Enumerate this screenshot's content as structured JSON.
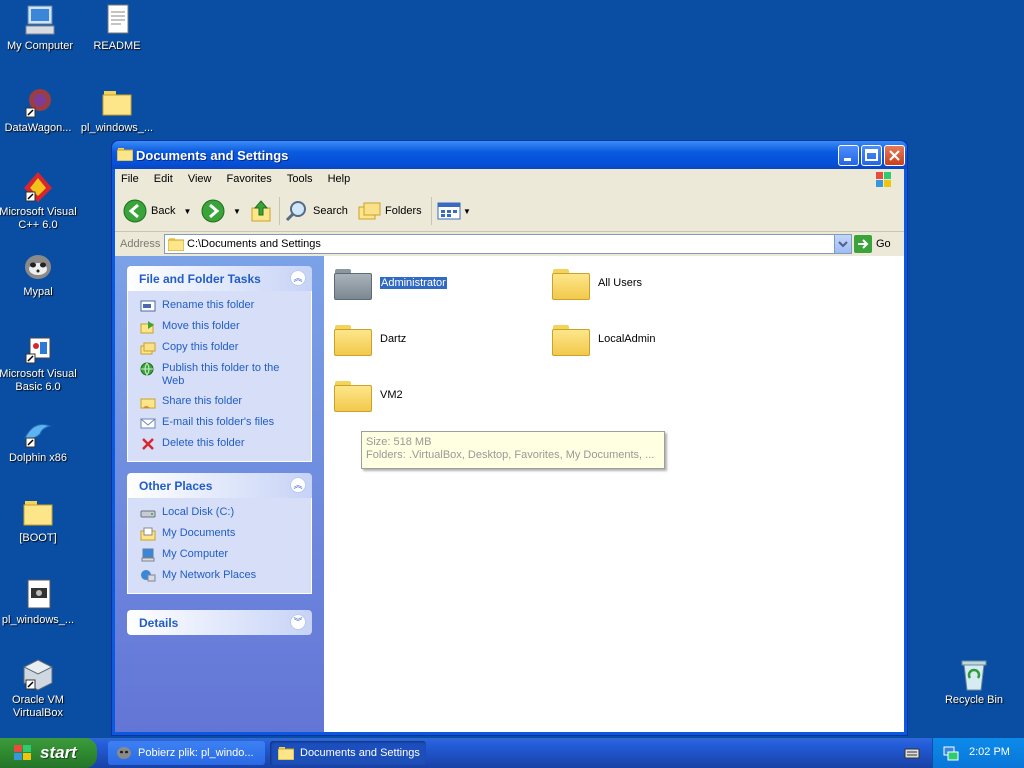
{
  "desktop": {
    "icons": [
      {
        "label": "My Computer"
      },
      {
        "label": "README"
      },
      {
        "label": "DataWagon..."
      },
      {
        "label": "pl_windows_..."
      },
      {
        "label": "Microsoft Visual C++ 6.0"
      },
      {
        "label": "Mypal"
      },
      {
        "label": "Microsoft Visual Basic 6.0"
      },
      {
        "label": "Dolphin x86"
      },
      {
        "label": "[BOOT]"
      },
      {
        "label": "pl_windows_..."
      },
      {
        "label": "Oracle VM VirtualBox"
      },
      {
        "label": "Recycle Bin"
      }
    ]
  },
  "window": {
    "title": "Documents and Settings",
    "menu": [
      "File",
      "Edit",
      "View",
      "Favorites",
      "Tools",
      "Help"
    ],
    "toolbar": {
      "back": "Back",
      "search": "Search",
      "folders": "Folders"
    },
    "address": {
      "label": "Address",
      "value": "C:\\Documents and Settings",
      "go": "Go"
    },
    "tasks_panel": {
      "title": "File and Folder Tasks",
      "items": [
        "Rename this folder",
        "Move this folder",
        "Copy this folder",
        "Publish this folder to the Web",
        "Share this folder",
        "E-mail this folder's files",
        "Delete this folder"
      ]
    },
    "places_panel": {
      "title": "Other Places",
      "items": [
        "Local Disk (C:)",
        "My Documents",
        "My Computer",
        "My Network Places"
      ]
    },
    "details_panel": {
      "title": "Details"
    },
    "folders": [
      {
        "name": "Administrator",
        "selected": true
      },
      {
        "name": "All Users"
      },
      {
        "name": "Dartz"
      },
      {
        "name": "LocalAdmin"
      },
      {
        "name": "VM2"
      }
    ],
    "tooltip": {
      "line1": "Size: 518 MB",
      "line2": "Folders: .VirtualBox, Desktop, Favorites, My Documents, ..."
    }
  },
  "taskbar": {
    "start": "start",
    "tasks": [
      {
        "label": "Pobierz plik: pl_windo..."
      },
      {
        "label": "Documents and Settings"
      }
    ],
    "clock": "2:02 PM"
  },
  "colors": {
    "accent": "#0a5ade",
    "link": "#215dc6",
    "desktop": "#0a4ea3"
  }
}
